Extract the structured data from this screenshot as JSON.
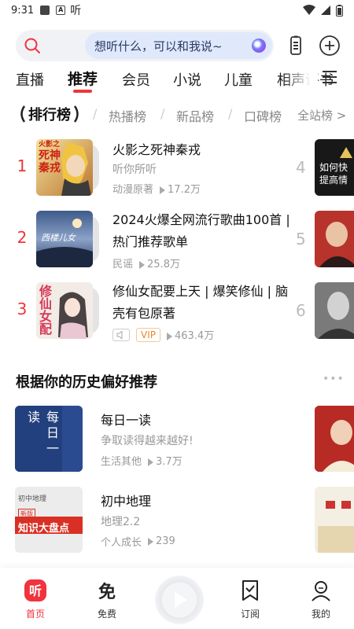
{
  "status_bar": {
    "time": "9:31",
    "notif_glyph": "A",
    "ting_glyph": "听"
  },
  "search": {
    "placeholder": "想听什么，可以和我说~"
  },
  "nav_tabs": [
    {
      "label": "直播"
    },
    {
      "label": "推荐",
      "active": true
    },
    {
      "label": "会员"
    },
    {
      "label": "小说"
    },
    {
      "label": "儿童"
    },
    {
      "label": "相声评书"
    }
  ],
  "rank": {
    "title": "排行榜",
    "tabs": [
      "热播榜",
      "新品榜",
      "口碑榜"
    ],
    "all_label": "全站榜 >",
    "items": [
      {
        "num": "1",
        "title": "火影之死神秦戎",
        "author": "听你所听",
        "tag": "动漫原著",
        "plays": "17.2万"
      },
      {
        "num": "2",
        "title": "2024火爆全网流行歌曲100首 | 热门推荐歌单",
        "tag": "民谣",
        "plays": "25.8万"
      },
      {
        "num": "3",
        "title": "修仙女配要上天 | 爆笑修仙 | 脑壳有包原著",
        "vip": "VIP",
        "plays": "463.4万"
      }
    ],
    "side_nums": [
      "4",
      "5",
      "6"
    ],
    "side_cover_4_text": [
      "如何快",
      "提高情"
    ]
  },
  "recommend": {
    "title": "根据你的历史偏好推荐",
    "more": "•••",
    "items": [
      {
        "title": "每日一读",
        "subtitle": "争取读得越来越好!",
        "tag": "生活其他",
        "plays": "3.7万",
        "cover_text": "每日一读"
      },
      {
        "title": "初中地理",
        "subtitle": "地理2.2",
        "tag": "个人成长",
        "plays": "239",
        "cover_text": "知识大盘点",
        "cover_top_text": "初中地理",
        "cover_badge": "新版"
      }
    ]
  },
  "covers": {
    "c1_text": [
      "火影之",
      "死神",
      "秦戎"
    ],
    "c2_text": "西楼儿女",
    "c3_text": "修仙女配"
  },
  "bottom_nav": [
    {
      "label": "首页",
      "active": true,
      "icon": "ting-home-icon",
      "glyph": "听"
    },
    {
      "label": "免费",
      "icon": "free-icon",
      "glyph": "免"
    },
    {
      "label": "订阅",
      "icon": "subscribe-icon"
    },
    {
      "label": "我的",
      "icon": "profile-icon"
    }
  ],
  "colors": {
    "accent": "#f0333c",
    "search_bg": "#f1f2f6",
    "pill_bg": "#dfe9fb",
    "vip": "#e8872a"
  }
}
